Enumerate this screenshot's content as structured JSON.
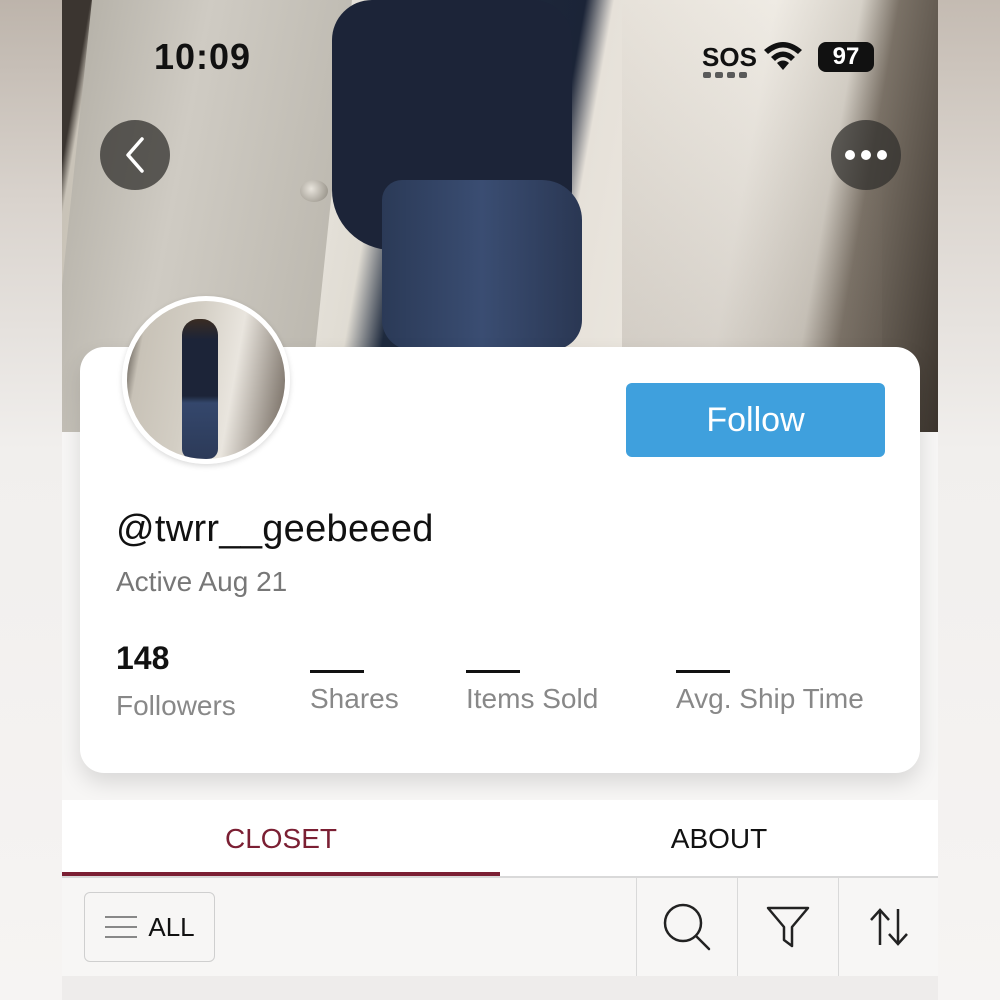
{
  "status_bar": {
    "time": "10:09",
    "carrier": "SOS",
    "battery": "97"
  },
  "header": {
    "back_icon": "chevron-left-icon",
    "more_icon": "more-horizontal-icon"
  },
  "profile": {
    "username": "@twrr__geebeeed",
    "active": "Active Aug 21",
    "follow_label": "Follow",
    "follow_color": "#3fa0dd",
    "stats": [
      {
        "value": "148",
        "label": "Followers"
      },
      {
        "value": "",
        "label": "Shares"
      },
      {
        "value": "",
        "label": "Items Sold"
      },
      {
        "value": "",
        "label": "Avg. Ship Time"
      }
    ]
  },
  "tabs": [
    {
      "label": "CLOSET",
      "active": true
    },
    {
      "label": "ABOUT",
      "active": false
    }
  ],
  "accent_color": "#7b1f33",
  "toolbar": {
    "all_label": "ALL",
    "icons": [
      "menu-icon",
      "search-icon",
      "filter-icon",
      "sort-icon"
    ]
  }
}
